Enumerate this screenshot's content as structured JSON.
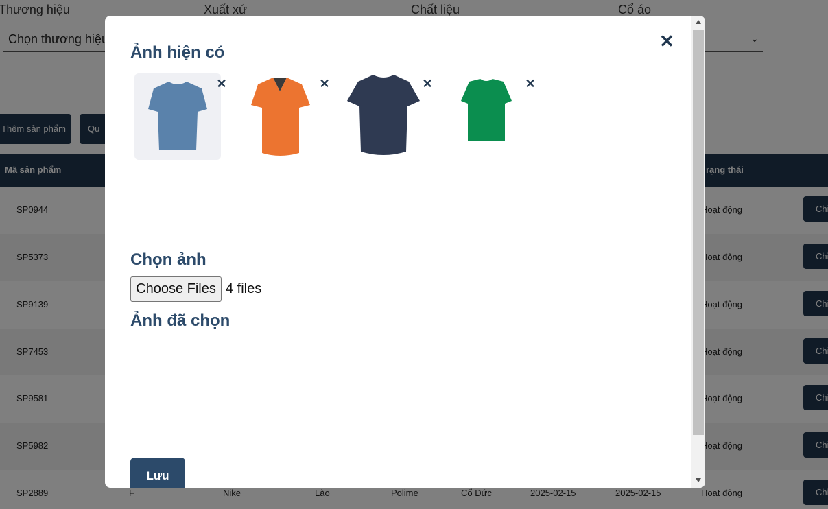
{
  "filters": {
    "labels": [
      "Thương hiệu",
      "Xuất xứ",
      "Chất liệu",
      "Cổ áo"
    ],
    "brand_placeholder": "Chọn thương hiệu"
  },
  "actions": {
    "add_product": "Thêm sản phẩm",
    "second_button_partial": "Qu"
  },
  "table": {
    "headers": {
      "code": "Mã sản phẩm",
      "status": "rạng thái"
    },
    "detail_label": "Chi",
    "rows": [
      {
        "code": "SP0944",
        "status": "Hoạt động"
      },
      {
        "code": "SP5373",
        "status": "Hoạt động"
      },
      {
        "code": "SP9139",
        "status": "Hoạt động"
      },
      {
        "code": "SP7453",
        "status": "Hoạt động"
      },
      {
        "code": "SP9581",
        "status": "Hoạt động"
      },
      {
        "code": "SP5982",
        "status": "Hoạt động"
      }
    ],
    "last_row": {
      "code": "SP2889",
      "col2": "F",
      "brand": "Nike",
      "origin": "Lào",
      "material": "Polime",
      "collar": "Cổ Đức",
      "created": "2025-02-15",
      "updated": "2025-02-15",
      "status": "Hoạt động"
    }
  },
  "modal": {
    "existing_heading": "Ảnh hiện có",
    "images": [
      {
        "name": "blue-tshirt",
        "color": "#5a82ab"
      },
      {
        "name": "orange-polo",
        "color": "#ec7430"
      },
      {
        "name": "navy-tshirt",
        "color": "#2f3a52"
      },
      {
        "name": "green-tshirt",
        "color": "#0b8e4f"
      }
    ],
    "choose_heading": "Chọn ảnh",
    "file_button": "Choose Files",
    "file_count": "4 files",
    "selected_heading": "Ảnh đã chọn",
    "save_label": "Lưu"
  },
  "colors": {
    "primary": "#21374f",
    "heading": "#2c4a6a",
    "overlay": "rgba(0,0,0,0.5)"
  }
}
